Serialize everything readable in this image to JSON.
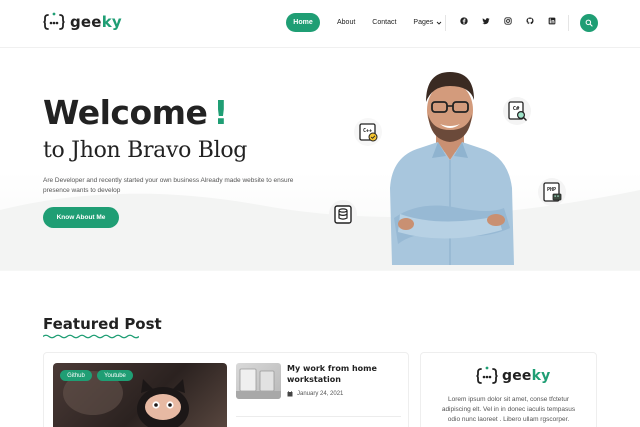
{
  "brand": {
    "name_part1": "gee",
    "name_part2": "ky",
    "accent": "#1f9e74"
  },
  "nav": {
    "home": "Home",
    "about": "About",
    "contact": "Contact",
    "pages": "Pages",
    "socials": [
      "facebook-icon",
      "twitter-icon",
      "instagram-icon",
      "github-icon",
      "linkedin-icon"
    ]
  },
  "hero": {
    "title": "Welcome",
    "bang": "!",
    "subtitle": "to Jhon Bravo Blog",
    "description": "Are Developer and recently started your own business Already made website to ensure presence wants to develop",
    "button": "Know About Me",
    "badges": [
      "C++",
      "C#",
      "PHP",
      "database-icon"
    ]
  },
  "featured": {
    "heading": "Featured Post",
    "tags": [
      "Github",
      "Youtube"
    ],
    "post": {
      "title": "My work from home workstation",
      "date": "January 24, 2021"
    }
  },
  "sidebar_widget": {
    "about_text": "Lorem ipsum dolor sit amet, conse tfctetur adipiscing elt. Vel in in donec iaculis tempasus odio nunc laoreet . Libero ullam rgscorper."
  }
}
